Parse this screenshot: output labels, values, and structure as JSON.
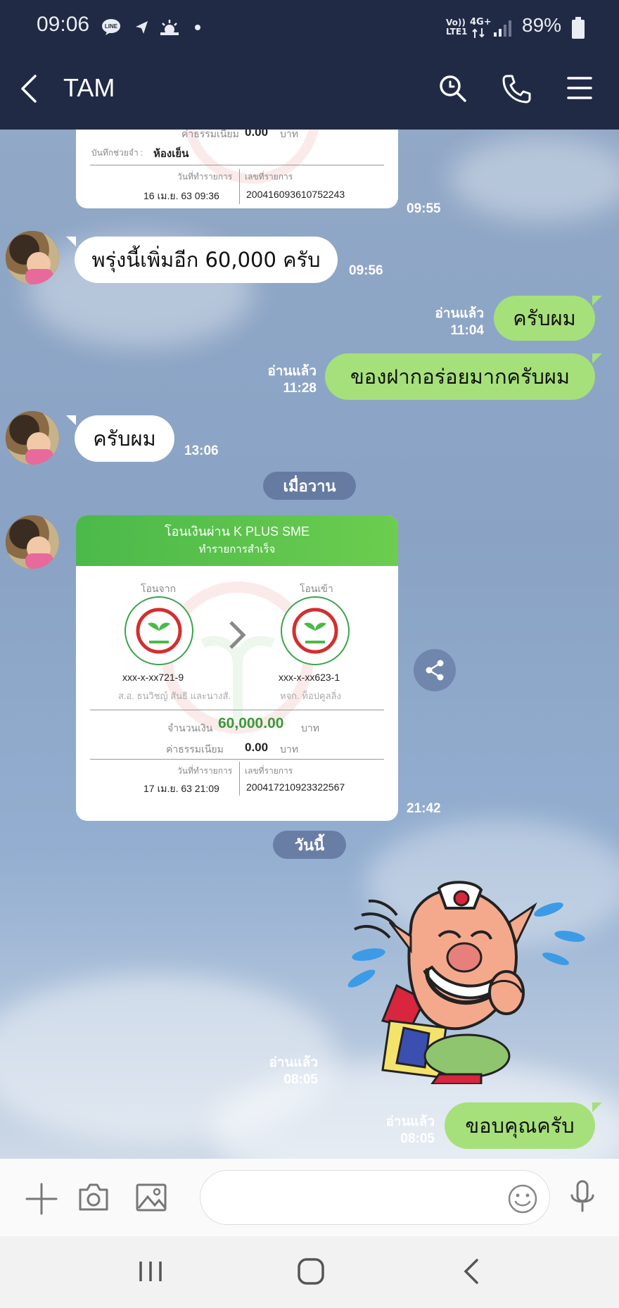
{
  "status_bar": {
    "time": "09:06",
    "volte_label": "Vo)) LTE1",
    "network_label": "4G+",
    "battery": "89%",
    "icons": [
      "line-app-icon",
      "navigation-icon",
      "weather-icon",
      "dot-icon",
      "signal-icon",
      "battery-icon"
    ]
  },
  "header": {
    "title": "TAM",
    "icons": [
      "back-arrow-icon",
      "search-icon",
      "phone-icon",
      "menu-icon"
    ]
  },
  "messages": {
    "slip1": {
      "fee_label": "ค่าธรรมเนียม",
      "fee_value": "0.00",
      "fee_unit": "บาท",
      "memo_label": "บันทึกช่วยจำ :",
      "memo_value": "ห้องเย็น",
      "date_label": "วันที่ทำรายการ",
      "ref_label": "เลขที่รายการ",
      "date_value": "16 เม.ย. 63 09:36",
      "ref_value": "200416093610752243",
      "time": "09:55"
    },
    "msg1": {
      "text": "พรุ่งนี้เพิ่มอีก 60,000 ครับ",
      "time": "09:56"
    },
    "msg2": {
      "text": "ครับผม",
      "read": "อ่านแล้ว",
      "time": "11:04"
    },
    "msg3": {
      "text": "ของฝากอร่อยมากครับผม",
      "read": "อ่านแล้ว",
      "time": "11:28"
    },
    "msg4": {
      "text": "ครับผม",
      "time": "13:06"
    },
    "divider_yesterday": "เมื่อวาน",
    "slip2": {
      "header_title": "โอนเงินผ่าน K PLUS SME",
      "header_sub": "ทำรายการสำเร็จ",
      "from_label": "โอนจาก",
      "to_label": "โอนเข้า",
      "from_account": "xxx-x-xx721-9",
      "to_account": "xxx-x-xx623-1",
      "from_name": "ส.อ. ธนวิชญ์ สันธิ และนางสั...",
      "to_name": "หจก. ท็อปคูลลิ่ง",
      "amount_label": "จำนวนเงิน",
      "amount_value": "60,000.00",
      "amount_unit": "บาท",
      "fee_label": "ค่าธรรมเนียม",
      "fee_value": "0.00",
      "fee_unit": "บาท",
      "date_label": "วันที่ทำรายการ",
      "ref_label": "เลขที่รายการ",
      "date_value": "17 เม.ย. 63 21:09",
      "ref_value": "200417210923322567",
      "time": "21:42"
    },
    "divider_today": "วันนี้",
    "sticker": {
      "read": "อ่านแล้ว",
      "time": "08:05"
    },
    "msg5": {
      "text": "ขอบคุณครับ",
      "read": "อ่านแล้ว",
      "time": "08:05"
    }
  },
  "input_bar": {
    "placeholder": "",
    "icons": [
      "plus-icon",
      "camera-icon",
      "image-icon",
      "emoji-icon",
      "microphone-icon"
    ]
  },
  "nav_bar": {
    "icons": [
      "recents-icon",
      "home-icon",
      "back-icon"
    ]
  },
  "colors": {
    "header_bg": "#212a45",
    "out_bubble": "#a6e07a",
    "in_bubble": "#ffffff",
    "kbank_green": "#4bb94a"
  }
}
